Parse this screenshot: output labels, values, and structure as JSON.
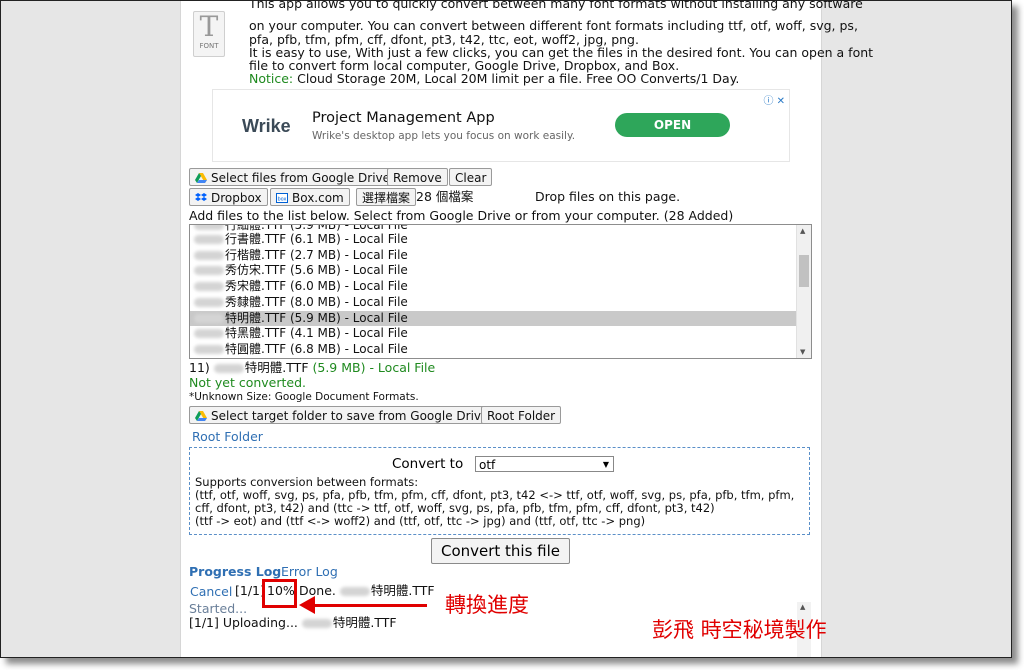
{
  "intro": {
    "line0": "This app allows you to quickly convert between many font formats without installing any software",
    "line1": "on your computer. You can convert between different font formats including ttf, otf, woff, svg, ps,",
    "line2": "pfa, pfb, tfm, pfm, cff, dfont, pt3, t42, ttc, eot, woff2, jpg, png.",
    "line3": "It is easy to use, With just a few clicks, you can get the files in the desired font. You can open a font",
    "line4": "file to convert form local computer, Google Drive, Dropbox, and Box.",
    "notice_label": "Notice:",
    "notice_text": " Cloud Storage 20M, Local 20M limit per a file. Free OO Converts/1 Day.",
    "icon_letter": "T",
    "icon_caption": "FONT"
  },
  "ad": {
    "brand": "Wrike",
    "title": "Project Management App",
    "subtitle": "Wrike's desktop app lets you focus on work easily.",
    "cta": "OPEN"
  },
  "toolbar": {
    "google_drive": "Select files from Google Drive",
    "remove": "Remove",
    "clear": "Clear",
    "dropbox": "Dropbox",
    "box": "Box.com",
    "choose_files": "選擇檔案",
    "file_count": "28 個檔案",
    "drop_hint": "Drop files on this page."
  },
  "list_hint": "Add files to the list below. Select from Google Drive or from your computer. (28 Added)",
  "file_list": [
    {
      "name": "行書體.TTF (6.1 MB) - Local File",
      "selected": false
    },
    {
      "name": "行楷體.TTF (2.7 MB) - Local File",
      "selected": false
    },
    {
      "name": "秀仿宋.TTF (5.6 MB) - Local File",
      "selected": false
    },
    {
      "name": "秀宋體.TTF (6.0 MB) - Local File",
      "selected": false
    },
    {
      "name": "秀隸體.TTF (8.0 MB) - Local File",
      "selected": false
    },
    {
      "name": "特明體.TTF (5.9 MB) - Local File",
      "selected": true
    },
    {
      "name": "特黑體.TTF (4.1 MB) - Local File",
      "selected": false
    },
    {
      "name": "特圓體.TTF (6.8 MB) - Local File",
      "selected": false
    }
  ],
  "detail": {
    "index": "11)",
    "filename": "特明體.TTF",
    "size_label": "(5.9 MB) - Local File",
    "status": "Not yet converted.",
    "unknown_note": "*Unknown Size: Google Document Formats."
  },
  "target": {
    "google_folder": "Select target folder to save from Google Drive",
    "root_button": "Root Folder",
    "root_link": "Root Folder"
  },
  "convert": {
    "label": "Convert to",
    "format": "otf",
    "supports": "Supports conversion between formats:",
    "line1": "(ttf, otf, woff, svg, ps, pfa, pfb, tfm, pfm, cff, dfont, pt3, t42 <-> ttf, otf, woff, svg, ps, pfa, pfb, tfm, pfm,",
    "line2": "cff, dfont, pt3, t42) and (ttc -> ttf, otf, woff, svg, ps, pfa, pfb, tfm, pfm, cff, dfont, pt3, t42)",
    "line3": "(ttf -> eot) and (ttf <-> woff2) and (ttf, otf, ttc -> jpg) and (ttf, otf, ttc -> png)",
    "button": "Convert this file"
  },
  "progress": {
    "tab_progress": "Progress Log",
    "tab_error": "Error Log",
    "cancel": "Cancel",
    "counter": "[1/1]",
    "percent": "10%",
    "done": "Done.",
    "filename": "特明體.TTF",
    "started": "Started...",
    "uploading": "[1/1] Uploading...",
    "upload_file": "特明體.TTF"
  },
  "annotations": {
    "arrow_label": "轉換進度",
    "credit": "彭飛 時空秘境製作"
  },
  "colors": {
    "accent_green": "#1f8a1f",
    "link_blue": "#2f6fb3",
    "annotation_red": "#e00000",
    "cta_green": "#2ea65a"
  }
}
